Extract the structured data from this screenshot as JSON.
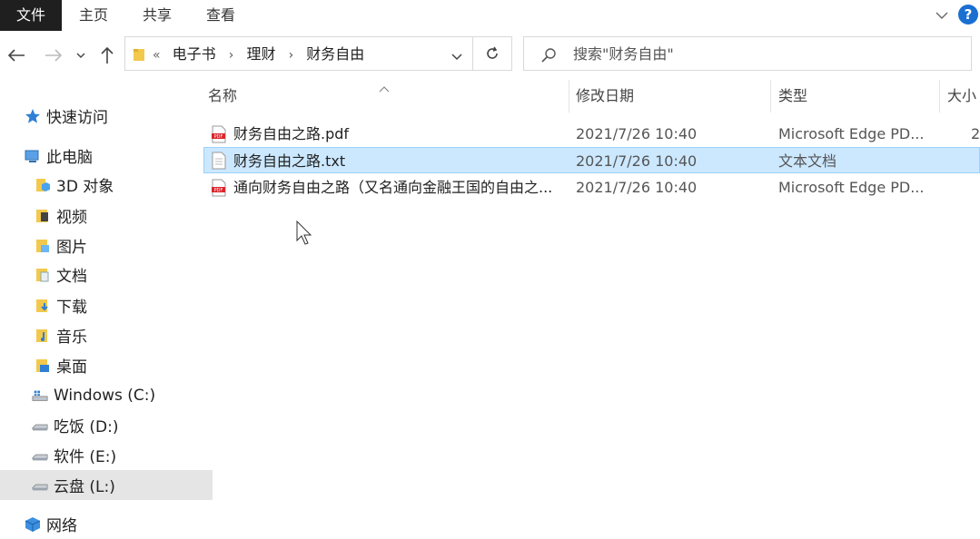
{
  "ribbon": {
    "tabs": [
      "文件",
      "主页",
      "共享",
      "查看"
    ],
    "help": "?"
  },
  "address": {
    "overflow": "«",
    "crumbs": [
      "电子书",
      "理财",
      "财务自由"
    ]
  },
  "search": {
    "placeholder": "搜索\"财务自由\""
  },
  "sidebar": {
    "items": [
      {
        "label": "快速访问",
        "icon": "star-icon"
      },
      {
        "label": "此电脑",
        "icon": "computer-icon"
      },
      {
        "label": "3D 对象",
        "icon": "3d-objects-icon"
      },
      {
        "label": "视频",
        "icon": "video-folder-icon"
      },
      {
        "label": "图片",
        "icon": "pictures-folder-icon"
      },
      {
        "label": "文档",
        "icon": "documents-folder-icon"
      },
      {
        "label": "下载",
        "icon": "download-folder-icon"
      },
      {
        "label": "音乐",
        "icon": "music-folder-icon"
      },
      {
        "label": "桌面",
        "icon": "desktop-folder-icon"
      },
      {
        "label": "Windows (C:)",
        "icon": "windows-drive-icon"
      },
      {
        "label": "吃饭 (D:)",
        "icon": "drive-icon"
      },
      {
        "label": "软件 (E:)",
        "icon": "drive-icon"
      },
      {
        "label": "云盘 (L:)",
        "icon": "drive-icon"
      },
      {
        "label": "网络",
        "icon": "network-icon"
      }
    ]
  },
  "columns": {
    "name": "名称",
    "date": "修改日期",
    "type": "类型",
    "size": "大小"
  },
  "files": [
    {
      "name": "财务自由之路.pdf",
      "date": "2021/7/26 10:40",
      "type": "Microsoft Edge PD...",
      "size": "2",
      "icon": "pdf-icon"
    },
    {
      "name": "财务自由之路.txt",
      "date": "2021/7/26 10:40",
      "type": "文本文档",
      "size": "",
      "icon": "text-file-icon"
    },
    {
      "name": "通向财务自由之路（又名通向金融王国的自由之...",
      "date": "2021/7/26 10:40",
      "type": "Microsoft Edge PD...",
      "size": "",
      "icon": "pdf-icon"
    }
  ]
}
